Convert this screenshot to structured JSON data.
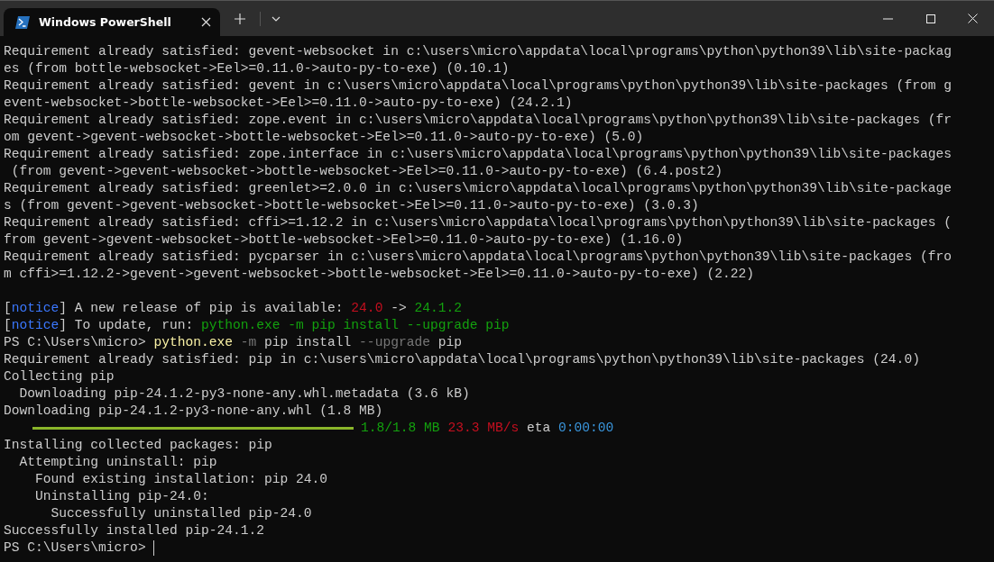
{
  "tab": {
    "title": "Windows PowerShell",
    "selected": true
  },
  "lines": [
    {
      "kind": "text",
      "segments": [
        {
          "text": "Requirement already satisfied: gevent-websocket in c:\\users\\micro\\appdata\\local\\programs\\python\\python39\\lib\\site-packag",
          "kind": "plain"
        }
      ]
    },
    {
      "kind": "text",
      "segments": [
        {
          "text": "es (from bottle-websocket->Eel>=0.11.0->auto-py-to-exe) (0.10.1)",
          "kind": "plain"
        }
      ]
    },
    {
      "kind": "text",
      "segments": [
        {
          "text": "Requirement already satisfied: gevent in c:\\users\\micro\\appdata\\local\\programs\\python\\python39\\lib\\site-packages (from g",
          "kind": "plain"
        }
      ]
    },
    {
      "kind": "text",
      "segments": [
        {
          "text": "event-websocket->bottle-websocket->Eel>=0.11.0->auto-py-to-exe) (24.2.1)",
          "kind": "plain"
        }
      ]
    },
    {
      "kind": "text",
      "segments": [
        {
          "text": "Requirement already satisfied: zope.event in c:\\users\\micro\\appdata\\local\\programs\\python\\python39\\lib\\site-packages (fr",
          "kind": "plain"
        }
      ]
    },
    {
      "kind": "text",
      "segments": [
        {
          "text": "om gevent->gevent-websocket->bottle-websocket->Eel>=0.11.0->auto-py-to-exe) (5.0)",
          "kind": "plain"
        }
      ]
    },
    {
      "kind": "text",
      "segments": [
        {
          "text": "Requirement already satisfied: zope.interface in c:\\users\\micro\\appdata\\local\\programs\\python\\python39\\lib\\site-packages",
          "kind": "plain"
        }
      ]
    },
    {
      "kind": "text",
      "segments": [
        {
          "text": " (from gevent->gevent-websocket->bottle-websocket->Eel>=0.11.0->auto-py-to-exe) (6.4.post2)",
          "kind": "plain"
        }
      ]
    },
    {
      "kind": "text",
      "segments": [
        {
          "text": "Requirement already satisfied: greenlet>=2.0.0 in c:\\users\\micro\\appdata\\local\\programs\\python\\python39\\lib\\site-package",
          "kind": "plain"
        }
      ]
    },
    {
      "kind": "text",
      "segments": [
        {
          "text": "s (from gevent->gevent-websocket->bottle-websocket->Eel>=0.11.0->auto-py-to-exe) (3.0.3)",
          "kind": "plain"
        }
      ]
    },
    {
      "kind": "text",
      "segments": [
        {
          "text": "Requirement already satisfied: cffi>=1.12.2 in c:\\users\\micro\\appdata\\local\\programs\\python\\python39\\lib\\site-packages (",
          "kind": "plain"
        }
      ]
    },
    {
      "kind": "text",
      "segments": [
        {
          "text": "from gevent->gevent-websocket->bottle-websocket->Eel>=0.11.0->auto-py-to-exe) (1.16.0)",
          "kind": "plain"
        }
      ]
    },
    {
      "kind": "text",
      "segments": [
        {
          "text": "Requirement already satisfied: pycparser in c:\\users\\micro\\appdata\\local\\programs\\python\\python39\\lib\\site-packages (fro",
          "kind": "plain"
        }
      ]
    },
    {
      "kind": "text",
      "segments": [
        {
          "text": "m cffi>=1.12.2->gevent->gevent-websocket->bottle-websocket->Eel>=0.11.0->auto-py-to-exe) (2.22)",
          "kind": "plain"
        }
      ]
    },
    {
      "kind": "blank"
    },
    {
      "kind": "text",
      "segments": [
        {
          "text": "[",
          "kind": "plain"
        },
        {
          "text": "notice",
          "kind": "notice"
        },
        {
          "text": "] A new release of pip is available: ",
          "kind": "plain"
        },
        {
          "text": "24.0",
          "kind": "red"
        },
        {
          "text": " -> ",
          "kind": "plain"
        },
        {
          "text": "24.1.2",
          "kind": "green"
        }
      ]
    },
    {
      "kind": "text",
      "segments": [
        {
          "text": "[",
          "kind": "plain"
        },
        {
          "text": "notice",
          "kind": "notice"
        },
        {
          "text": "] To update, run: ",
          "kind": "plain"
        },
        {
          "text": "python.exe -m pip install --upgrade pip",
          "kind": "green"
        }
      ]
    },
    {
      "kind": "text",
      "segments": [
        {
          "text": "PS C:\\Users\\micro> ",
          "kind": "plain"
        },
        {
          "text": "python.exe",
          "kind": "yellow"
        },
        {
          "text": " -m",
          "kind": "dim"
        },
        {
          "text": " pip install",
          "kind": "plain"
        },
        {
          "text": " --upgrade",
          "kind": "dim"
        },
        {
          "text": " pip",
          "kind": "plain"
        }
      ]
    },
    {
      "kind": "text",
      "segments": [
        {
          "text": "Requirement already satisfied: pip in c:\\users\\micro\\appdata\\local\\programs\\python\\python39\\lib\\site-packages (24.0)",
          "kind": "plain"
        }
      ]
    },
    {
      "kind": "text",
      "segments": [
        {
          "text": "Collecting pip",
          "kind": "plain"
        }
      ]
    },
    {
      "kind": "text",
      "segments": [
        {
          "text": "  Downloading pip-24.1.2-py3-none-any.whl.metadata (3.6 kB)",
          "kind": "plain"
        }
      ]
    },
    {
      "kind": "text",
      "segments": [
        {
          "text": "Downloading pip-24.1.2-py3-none-any.whl (1.8 MB)",
          "kind": "plain"
        }
      ]
    },
    {
      "kind": "progress",
      "level": 1,
      "segments": [
        {
          "text": "1.8/1.8 MB",
          "kind": "green"
        },
        {
          "text": "23.3 MB/s",
          "kind": "red"
        },
        {
          "text": "eta",
          "kind": "plain"
        },
        {
          "text": "0:00:00",
          "kind": "blue"
        }
      ]
    },
    {
      "kind": "text",
      "segments": [
        {
          "text": "Installing collected packages: pip",
          "kind": "plain"
        }
      ]
    },
    {
      "kind": "text",
      "segments": [
        {
          "text": "  Attempting uninstall: pip",
          "kind": "plain"
        }
      ]
    },
    {
      "kind": "text",
      "segments": [
        {
          "text": "    Found existing installation: pip 24.0",
          "kind": "plain"
        }
      ]
    },
    {
      "kind": "text",
      "segments": [
        {
          "text": "    Uninstalling pip-24.0:",
          "kind": "plain"
        }
      ]
    },
    {
      "kind": "text",
      "segments": [
        {
          "text": "      Successfully uninstalled pip-24.0",
          "kind": "plain"
        }
      ]
    },
    {
      "kind": "text",
      "segments": [
        {
          "text": "Successfully installed pip-24.1.2",
          "kind": "plain"
        }
      ]
    },
    {
      "kind": "prompt",
      "segments": [
        {
          "text": "PS C:\\Users\\micro> ",
          "kind": "plain"
        }
      ]
    }
  ]
}
